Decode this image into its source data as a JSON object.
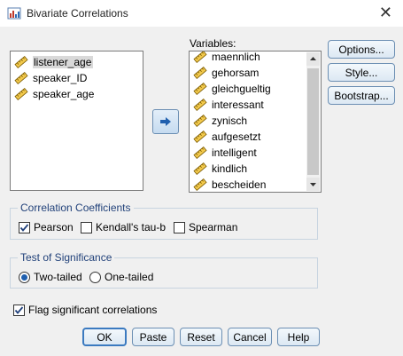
{
  "window": {
    "title": "Bivariate Correlations"
  },
  "source_list": {
    "items": [
      "listener_age",
      "speaker_ID",
      "speaker_age"
    ],
    "selected_index": 0
  },
  "variables": {
    "label": "Variables:",
    "items": [
      "maennlich",
      "gehorsam",
      "gleichgueltig",
      "interessant",
      "zynisch",
      "aufgesetzt",
      "intelligent",
      "kindlich",
      "bescheiden"
    ]
  },
  "side_buttons": {
    "options": "Options...",
    "style": "Style...",
    "bootstrap": "Bootstrap..."
  },
  "correlation_coefficients": {
    "legend": "Correlation Coefficients",
    "pearson": {
      "label": "Pearson",
      "checked": true
    },
    "kendall": {
      "label": "Kendall's tau-b",
      "checked": false
    },
    "spearman": {
      "label": "Spearman",
      "checked": false
    }
  },
  "test_of_significance": {
    "legend": "Test of Significance",
    "two_tailed": {
      "label": "Two-tailed",
      "selected": true
    },
    "one_tailed": {
      "label": "One-tailed",
      "selected": false
    }
  },
  "flag": {
    "label": "Flag significant correlations",
    "checked": true
  },
  "footer_buttons": {
    "ok": "OK",
    "paste": "Paste",
    "reset": "Reset",
    "cancel": "Cancel",
    "help": "Help"
  },
  "colors": {
    "accent": "#3b7ac0",
    "legend_text": "#22427a",
    "selected_item_bg": "#d9d9d9"
  },
  "icons": {
    "variable": "scale-ruler-icon",
    "move": "arrow-right-icon",
    "app": "spss-app-icon"
  }
}
